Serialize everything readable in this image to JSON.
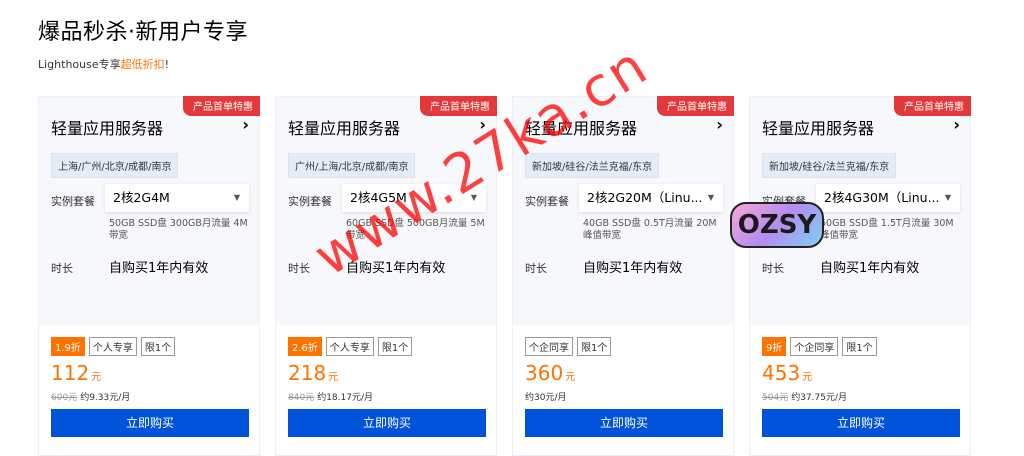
{
  "header": {
    "title": "爆品秒杀·新用户专享",
    "subtitle_prefix": "Lighthouse专享",
    "subtitle_highlight": "超低折扣",
    "subtitle_suffix": "!"
  },
  "colors": {
    "accent": "#ff7200",
    "button": "#0052d9",
    "ribbon": "#e4393c"
  },
  "cards": [
    {
      "ribbon": "产品首单特惠",
      "title": "轻量应用服务器",
      "region": "上海/广州/北京/成都/南京",
      "spec_label": "实例套餐",
      "spec_value": "2核2G4M",
      "spec_desc": "50GB SSD盘 300GB月流量 4M带宽",
      "duration_label": "时长",
      "duration_value": "自购买1年内有效",
      "tags": [
        "1.9折",
        "个人专享",
        "限1个"
      ],
      "price": "112",
      "price_unit": "元",
      "original_price": "600元",
      "monthly": "约9.33元/月",
      "buy_label": "立即购买"
    },
    {
      "ribbon": "产品首单特惠",
      "title": "轻量应用服务器",
      "region": "广州/上海/北京/成都/南京",
      "spec_label": "实例套餐",
      "spec_value": "2核4G5M",
      "spec_desc": "60GB SSD盘 500GB月流量 5M带宽",
      "duration_label": "时长",
      "duration_value": "自购买1年内有效",
      "tags": [
        "2.6折",
        "个人专享",
        "限1个"
      ],
      "price": "218",
      "price_unit": "元",
      "original_price": "840元",
      "monthly": "约18.17元/月",
      "buy_label": "立即购买"
    },
    {
      "ribbon": "产品首单特惠",
      "title": "轻量应用服务器",
      "region": "新加坡/硅谷/法兰克福/东京",
      "spec_label": "实例套餐",
      "spec_value": "2核2G20M（Linu...",
      "spec_desc": "40GB SSD盘 0.5T月流量 20M 峰值带宽",
      "duration_label": "时长",
      "duration_value": "自购买1年内有效",
      "tags": [
        "个企同享",
        "限1个"
      ],
      "price": "360",
      "price_unit": "元",
      "original_price": "",
      "monthly": "约30元/月",
      "buy_label": "立即购买"
    },
    {
      "ribbon": "产品首单特惠",
      "title": "轻量应用服务器",
      "region": "新加坡/硅谷/法兰克福/东京",
      "spec_label": "实例套餐",
      "spec_value": "2核4G30M（Linu...",
      "spec_desc": "60GB SSD盘 1.5T月流量 30M 峰值带宽",
      "duration_label": "时长",
      "duration_value": "自购买1年内有效",
      "tags": [
        "9折",
        "个企同享",
        "限1个"
      ],
      "price": "453",
      "price_unit": "元",
      "original_price": "504元",
      "monthly": "约37.75元/月",
      "buy_label": "立即购买"
    }
  ],
  "watermark": "www.27ka.cn",
  "logo_text": "OZSY"
}
